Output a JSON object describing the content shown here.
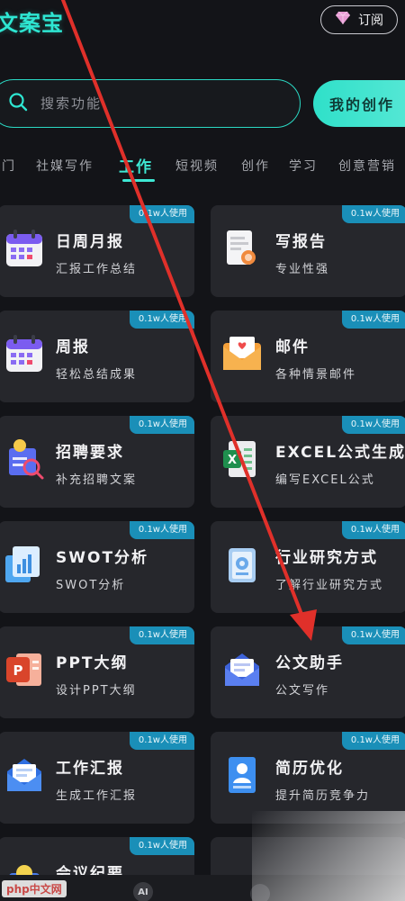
{
  "header": {
    "logo": "文案宝",
    "subscribe_label": "订阅"
  },
  "search": {
    "placeholder": "搜索功能",
    "create_label": "我的创作"
  },
  "tabs": [
    {
      "label": "门",
      "active": false
    },
    {
      "label": "社媒写作",
      "active": false
    },
    {
      "label": "工作",
      "active": true
    },
    {
      "label": "短视频",
      "active": false
    },
    {
      "label": "创作",
      "active": false
    },
    {
      "label": "学习",
      "active": false
    },
    {
      "label": "创意营销",
      "active": false
    }
  ],
  "cards": [
    {
      "title": "日周月报",
      "desc": "汇报工作总结",
      "badge": "0.1w人使用",
      "icon": "calendar-icon"
    },
    {
      "title": "写报告",
      "desc": "专业性强",
      "badge": "0.1w人使用",
      "icon": "report-icon"
    },
    {
      "title": "周报",
      "desc": "轻松总结成果",
      "badge": "0.1w人使用",
      "icon": "calendar-icon"
    },
    {
      "title": "邮件",
      "desc": "各种情景邮件",
      "badge": "0.1w人使用",
      "icon": "mail-icon"
    },
    {
      "title": "招聘要求",
      "desc": "补充招聘文案",
      "badge": "0.1w人使用",
      "icon": "recruit-icon"
    },
    {
      "title": "EXCEL公式生成",
      "desc": "编写EXCEL公式",
      "badge": "0.1w人使用",
      "icon": "excel-icon"
    },
    {
      "title": "SWOT分析",
      "desc": "SWOT分析",
      "badge": "0.1w人使用",
      "icon": "swot-icon"
    },
    {
      "title": "行业研究方式",
      "desc": "了解行业研究方式",
      "badge": "0.1w人使用",
      "icon": "research-icon"
    },
    {
      "title": "PPT大纲",
      "desc": "设计PPT大纲",
      "badge": "0.1w人使用",
      "icon": "ppt-icon"
    },
    {
      "title": "公文助手",
      "desc": "公文写作",
      "badge": "0.1w人使用",
      "icon": "envelope-icon"
    },
    {
      "title": "工作汇报",
      "desc": "生成工作汇报",
      "badge": "0.1w人使用",
      "icon": "envelope-icon"
    },
    {
      "title": "简历优化",
      "desc": "提升简历竞争力",
      "badge": "0.1w人使用",
      "icon": "resume-icon"
    },
    {
      "title": "会议纪要",
      "desc": "",
      "badge": "0.1w人使用",
      "icon": "meeting-icon"
    },
    {
      "title": "",
      "desc": "",
      "badge": "",
      "icon": "generic-icon"
    }
  ],
  "bottom": {
    "ai_label": "AI"
  },
  "watermark": "php中文网",
  "colors": {
    "accent": "#2ee6d2",
    "card_bg": "#26272c",
    "badge_bg": "#1a8fb8",
    "arrow": "#e0302a"
  }
}
